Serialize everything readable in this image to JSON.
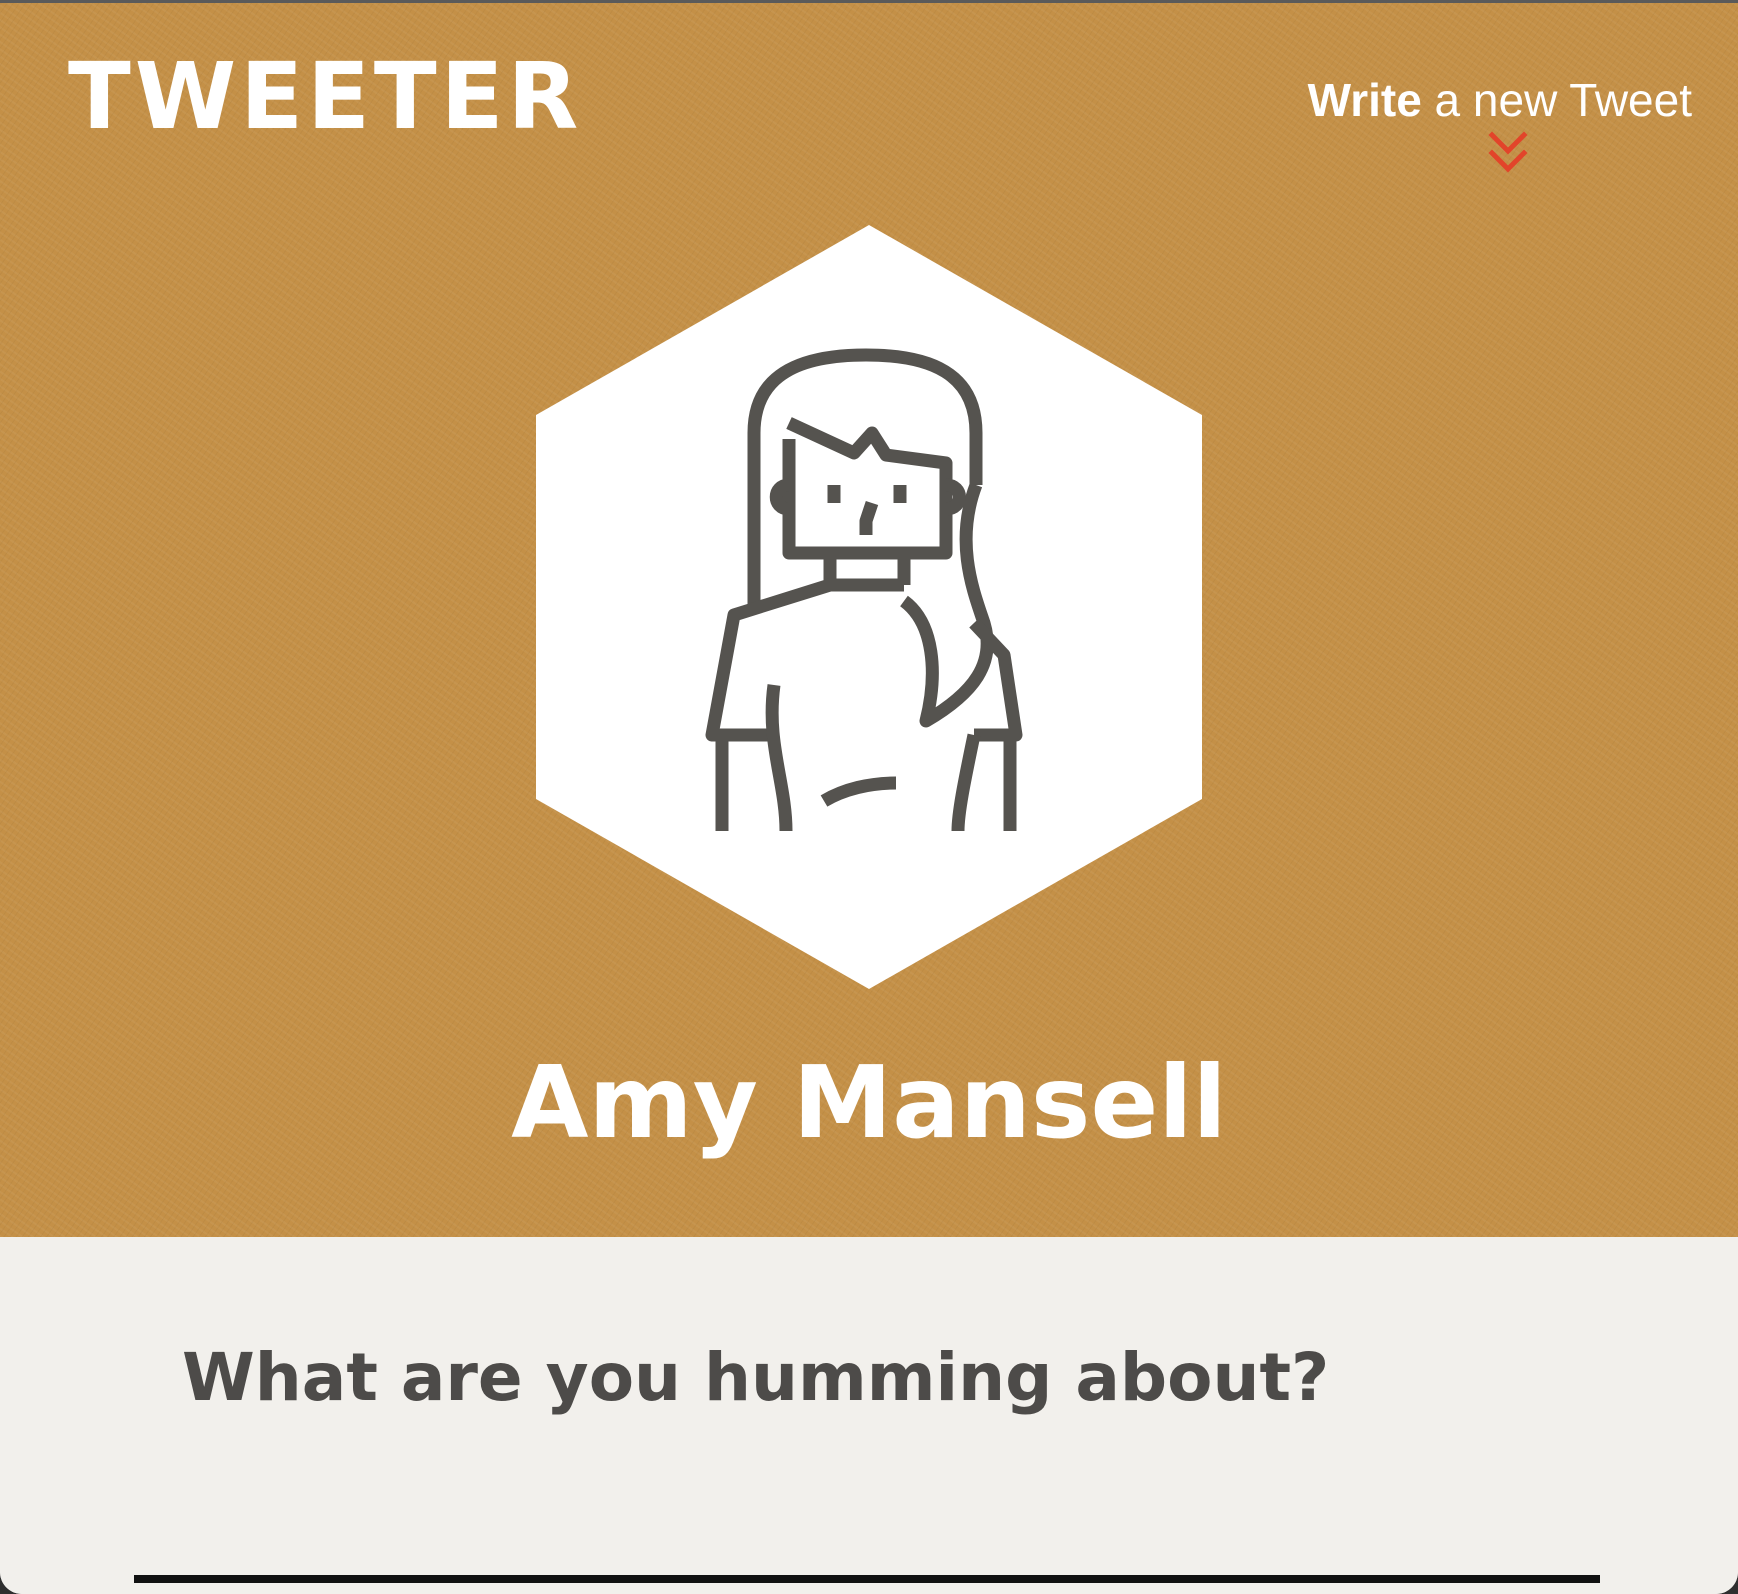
{
  "header": {
    "logo": "TWEETER",
    "write_link": {
      "strong": "Write",
      "rest": " a new Tweet"
    },
    "chevron_icon": "double-chevron-down-icon"
  },
  "profile": {
    "avatar_icon": "woman-avatar-icon",
    "name": "Amy Mansell"
  },
  "compose": {
    "prompt": "What are you humming about?"
  },
  "colors": {
    "header_bg": "#c49047",
    "compose_bg": "#f2f0ec",
    "accent": "#e2442a",
    "avatar_stroke": "#55534f",
    "prompt_text": "#4d4b49"
  }
}
